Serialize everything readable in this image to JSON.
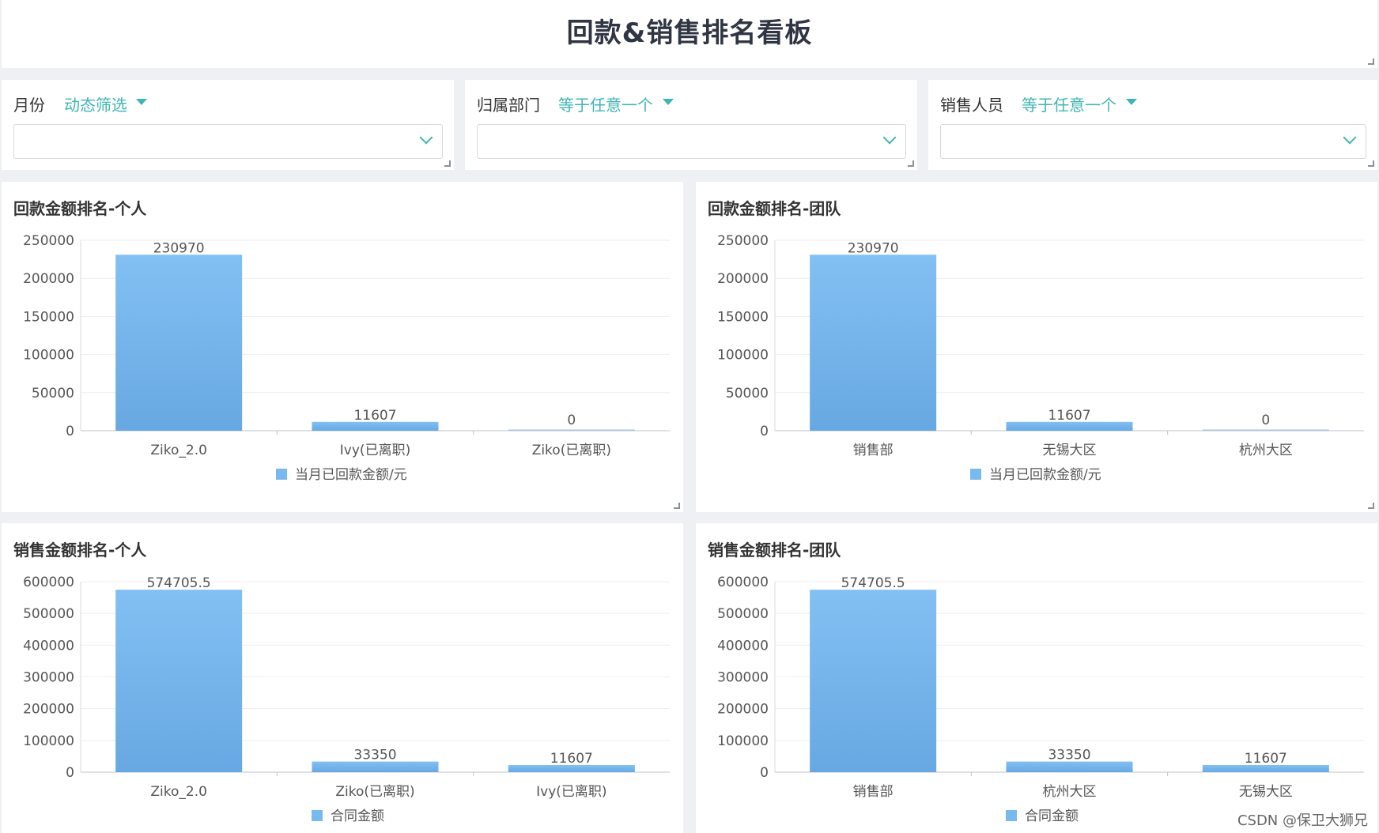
{
  "dashboard": {
    "title": "回款&销售排名看板"
  },
  "filters": [
    {
      "label": "月份",
      "mode": "动态筛选",
      "value": ""
    },
    {
      "label": "归属部门",
      "mode": "等于任意一个",
      "value": ""
    },
    {
      "label": "销售人员",
      "mode": "等于任意一个",
      "value": ""
    }
  ],
  "colors": {
    "bar": "#78b9ee",
    "accent": "#3fb6b2"
  },
  "chart_data": [
    {
      "title": "回款金额排名-个人",
      "type": "bar",
      "categories": [
        "Ziko_2.0",
        "Ivy(已离职)",
        "Ziko(已离职)"
      ],
      "values": [
        230970,
        11607,
        0
      ],
      "value_labels": [
        "230970",
        "11607",
        "0"
      ],
      "ylim": [
        0,
        250000
      ],
      "yticks": [
        0,
        50000,
        100000,
        150000,
        200000,
        250000
      ],
      "legend": "当月已回款金额/元"
    },
    {
      "title": "回款金额排名-团队",
      "type": "bar",
      "categories": [
        "销售部",
        "无锡大区",
        "杭州大区"
      ],
      "values": [
        230970,
        11607,
        0
      ],
      "value_labels": [
        "230970",
        "11607",
        "0"
      ],
      "ylim": [
        0,
        250000
      ],
      "yticks": [
        0,
        50000,
        100000,
        150000,
        200000,
        250000
      ],
      "legend": "当月已回款金额/元"
    },
    {
      "title": "销售金额排名-个人",
      "type": "bar",
      "categories": [
        "Ziko_2.0",
        "Ziko(已离职)",
        "Ivy(已离职)"
      ],
      "values": [
        574705.5,
        33350,
        11607
      ],
      "value_labels": [
        "574705.5",
        "33350",
        "11607"
      ],
      "ylim": [
        0,
        600000
      ],
      "yticks": [
        0,
        100000,
        200000,
        300000,
        400000,
        500000,
        600000
      ],
      "legend": "合同金额"
    },
    {
      "title": "销售金额排名-团队",
      "type": "bar",
      "categories": [
        "销售部",
        "杭州大区",
        "无锡大区"
      ],
      "values": [
        574705.5,
        33350,
        11607
      ],
      "value_labels": [
        "574705.5",
        "33350",
        "11607"
      ],
      "ylim": [
        0,
        600000
      ],
      "yticks": [
        0,
        100000,
        200000,
        300000,
        400000,
        500000,
        600000
      ],
      "legend": "合同金额"
    }
  ],
  "watermark": "CSDN @保卫大狮兄"
}
